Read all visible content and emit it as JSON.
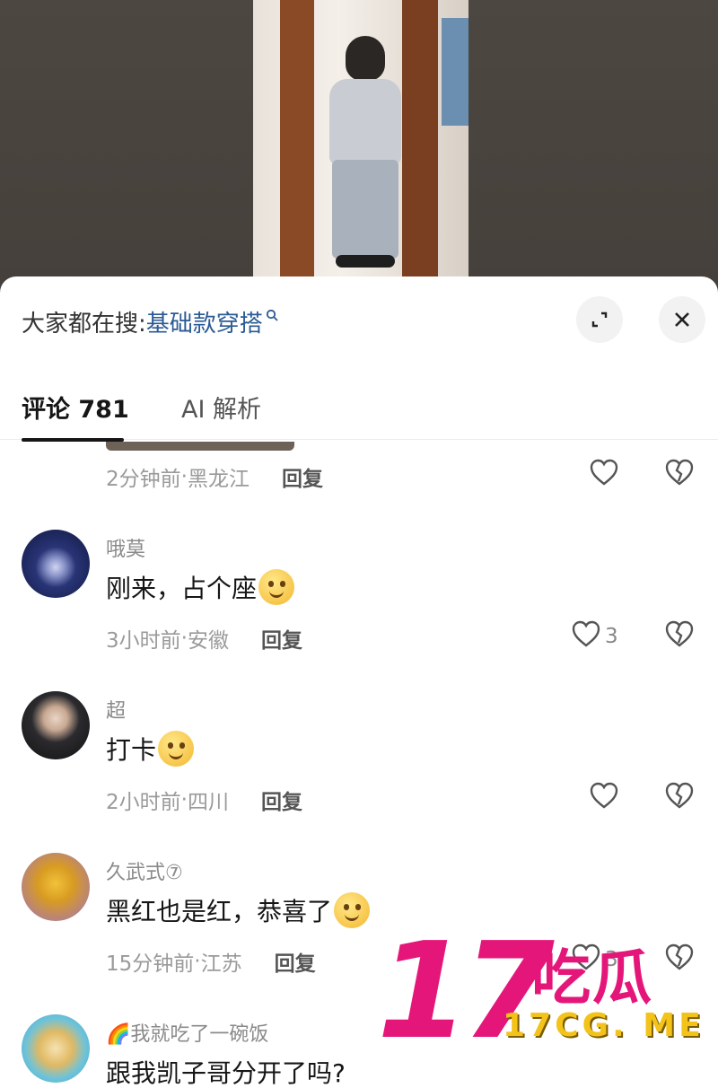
{
  "search_bar": {
    "prefix": "大家都在搜:",
    "term": "基础款穿搭"
  },
  "tabs": [
    {
      "label": "评论 781",
      "active": true
    },
    {
      "label": "AI 解析",
      "active": false
    }
  ],
  "comments": [
    {
      "username": "",
      "content": "",
      "time": "2分钟前",
      "location": "黑龙江",
      "reply_label": "回复",
      "likes": ""
    },
    {
      "username": "哦莫",
      "content": "刚来，占个座",
      "time": "3小时前",
      "location": "安徽",
      "reply_label": "回复",
      "likes": "3"
    },
    {
      "username": "超",
      "content": "打卡",
      "time": "2小时前",
      "location": "四川",
      "reply_label": "回复",
      "likes": ""
    },
    {
      "username": "久武式⑦",
      "content": "黑红也是红，恭喜了",
      "time": "15分钟前",
      "location": "江苏",
      "reply_label": "回复",
      "likes": "3"
    },
    {
      "username": "🌈我就吃了一碗饭",
      "content": "跟我凯子哥分开了吗?",
      "time": "",
      "location": "",
      "reply_label": "",
      "likes": ""
    }
  ],
  "watermark": {
    "number": "17",
    "name": "吃瓜",
    "url": "17CG. ME"
  },
  "colors": {
    "link": "#2b5a94",
    "watermark_pink": "#e5167a",
    "watermark_yellow": "#f3c31a"
  }
}
